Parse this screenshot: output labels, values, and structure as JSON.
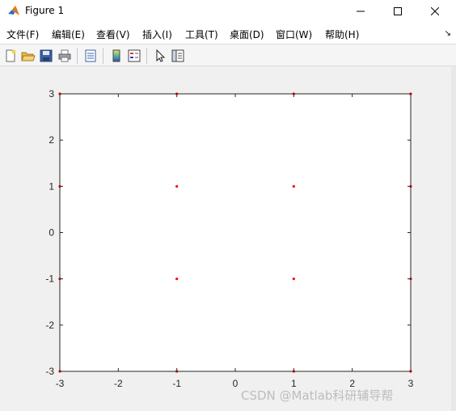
{
  "window": {
    "title": "Figure 1"
  },
  "menu": {
    "items": [
      {
        "label": "文件(F)"
      },
      {
        "label": "编辑(E)"
      },
      {
        "label": "查看(V)"
      },
      {
        "label": "插入(I)"
      },
      {
        "label": "工具(T)"
      },
      {
        "label": "桌面(D)"
      },
      {
        "label": "窗口(W)"
      },
      {
        "label": "帮助(H)"
      }
    ],
    "overflow_icon": "chevron-icon"
  },
  "toolbar": {
    "buttons": [
      "new-figure-icon",
      "open-file-icon",
      "save-icon",
      "print-icon",
      "print-preview-icon",
      "colorbar-icon",
      "legend-icon",
      "pointer-icon",
      "plot-browser-icon"
    ]
  },
  "chart_data": {
    "type": "scatter",
    "xlim": [
      -3,
      3
    ],
    "ylim": [
      -3,
      3
    ],
    "xticks": [
      -3,
      -2,
      -1,
      0,
      1,
      2,
      3
    ],
    "yticks": [
      -3,
      -2,
      -1,
      0,
      1,
      2,
      3
    ],
    "grid": false,
    "marker_color": "#ff0000",
    "points": [
      {
        "x": -3,
        "y": 3
      },
      {
        "x": -1,
        "y": 3
      },
      {
        "x": 1,
        "y": 3
      },
      {
        "x": 3,
        "y": 3
      },
      {
        "x": -3,
        "y": 1
      },
      {
        "x": -1,
        "y": 1
      },
      {
        "x": 1,
        "y": 1
      },
      {
        "x": 3,
        "y": 1
      },
      {
        "x": -3,
        "y": -1
      },
      {
        "x": -1,
        "y": -1
      },
      {
        "x": 1,
        "y": -1
      },
      {
        "x": 3,
        "y": -1
      },
      {
        "x": -3,
        "y": -3
      },
      {
        "x": -1,
        "y": -3
      },
      {
        "x": 1,
        "y": -3
      },
      {
        "x": 3,
        "y": -3
      }
    ]
  },
  "watermark": "CSDN @Matlab科研辅导帮"
}
